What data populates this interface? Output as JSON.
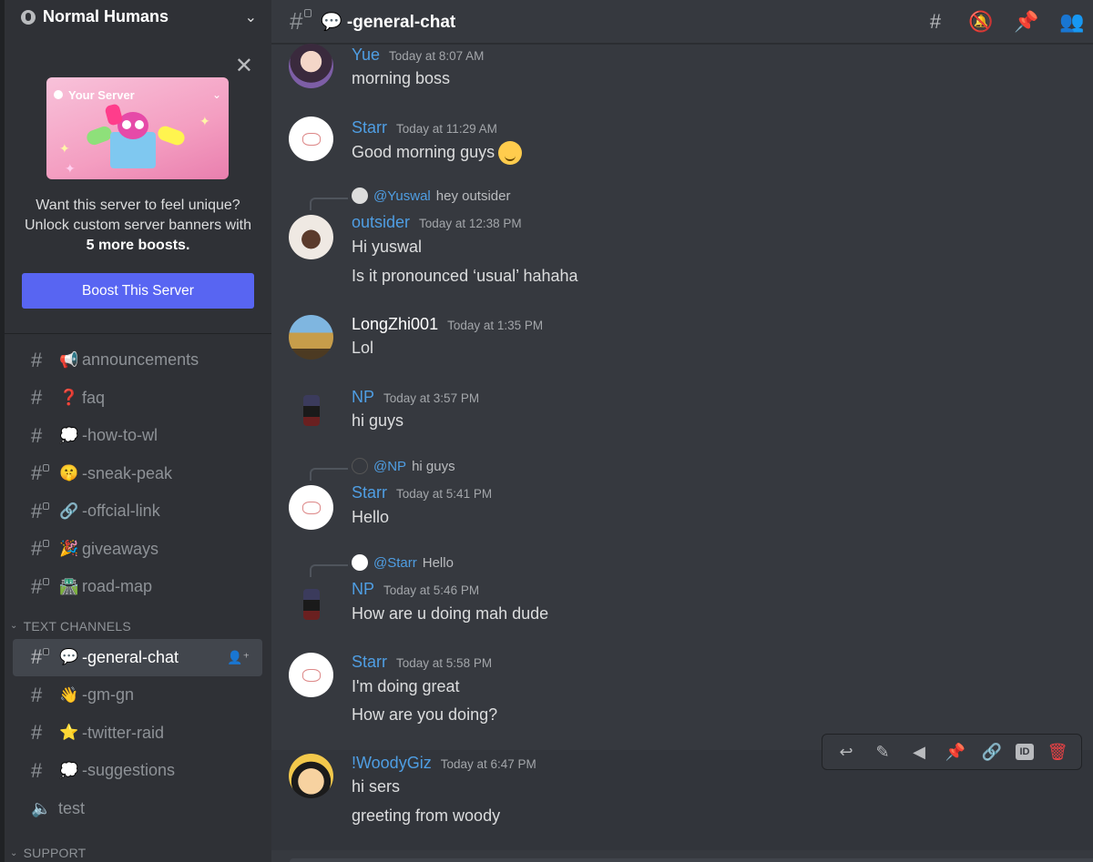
{
  "server": {
    "name": "Normal Humans"
  },
  "boost": {
    "banner_label": "Your Server",
    "line1": "Want this server to feel unique?",
    "line2": "Unlock custom server banners with",
    "line3": "5 more boosts.",
    "button": "Boost This Server"
  },
  "channels_top": [
    {
      "emoji": "📢",
      "name": "announcements",
      "locked": false
    },
    {
      "emoji": "❓",
      "name": "faq",
      "locked": false
    },
    {
      "emoji": "💭",
      "name": "-how-to-wl",
      "locked": false
    },
    {
      "emoji": "🤫",
      "name": "-sneak-peak",
      "locked": true
    },
    {
      "emoji": "🔗",
      "name": "-offcial-link",
      "locked": true
    },
    {
      "emoji": "🎉",
      "name": "giveaways",
      "locked": true
    },
    {
      "emoji": "🛣️",
      "name": "road-map",
      "locked": true
    }
  ],
  "category_text": "TEXT CHANNELS",
  "channels_text": [
    {
      "emoji": "💬",
      "name": "-general-chat",
      "locked": true,
      "active": true
    },
    {
      "emoji": "👋",
      "name": "-gm-gn",
      "locked": false
    },
    {
      "emoji": "⭐",
      "name": "-twitter-raid",
      "locked": false
    },
    {
      "emoji": "💭",
      "name": "-suggestions",
      "locked": false
    }
  ],
  "voice_channel": {
    "name": "test"
  },
  "category_support": "SUPPORT",
  "header": {
    "channel": "💬 -general-chat"
  },
  "messages": [
    {
      "author": "Yue",
      "time": "Today at 8:07 AM",
      "lines": [
        "morning boss"
      ]
    },
    {
      "author": "Starr",
      "time": "Today at 11:29 AM",
      "lines": [
        "Good morning guys"
      ]
    },
    {
      "reply_to": "@Yuswal",
      "reply_text": "hey outsider",
      "author": "outsider",
      "time": "Today at 12:38 PM",
      "lines": [
        "Hi yuswal",
        "Is it pronounced ‘usual’ hahaha"
      ]
    },
    {
      "author": "LongZhi001",
      "time": "Today at 1:35 PM",
      "lines": [
        "Lol"
      ]
    },
    {
      "author": "NP",
      "time": "Today at 3:57 PM",
      "lines": [
        "hi guys"
      ]
    },
    {
      "reply_to": "@NP",
      "reply_text": "hi guys",
      "author": "Starr",
      "time": "Today at 5:41 PM",
      "lines": [
        "Hello"
      ]
    },
    {
      "reply_to": "@Starr",
      "reply_text": "Hello",
      "author": "NP",
      "time": "Today at 5:46 PM",
      "lines": [
        "How are u doing mah dude"
      ]
    },
    {
      "author": "Starr",
      "time": "Today at 5:58 PM",
      "lines": [
        "I'm doing great",
        "How are you doing?"
      ]
    },
    {
      "author": "!WoodyGiz",
      "time": "Today at 6:47 PM",
      "lines": [
        "hi sers",
        "greeting from woody"
      ]
    }
  ],
  "colors": {
    "accent": "#5865f2",
    "username": "#4f9ee3",
    "danger": "#ed4245"
  }
}
